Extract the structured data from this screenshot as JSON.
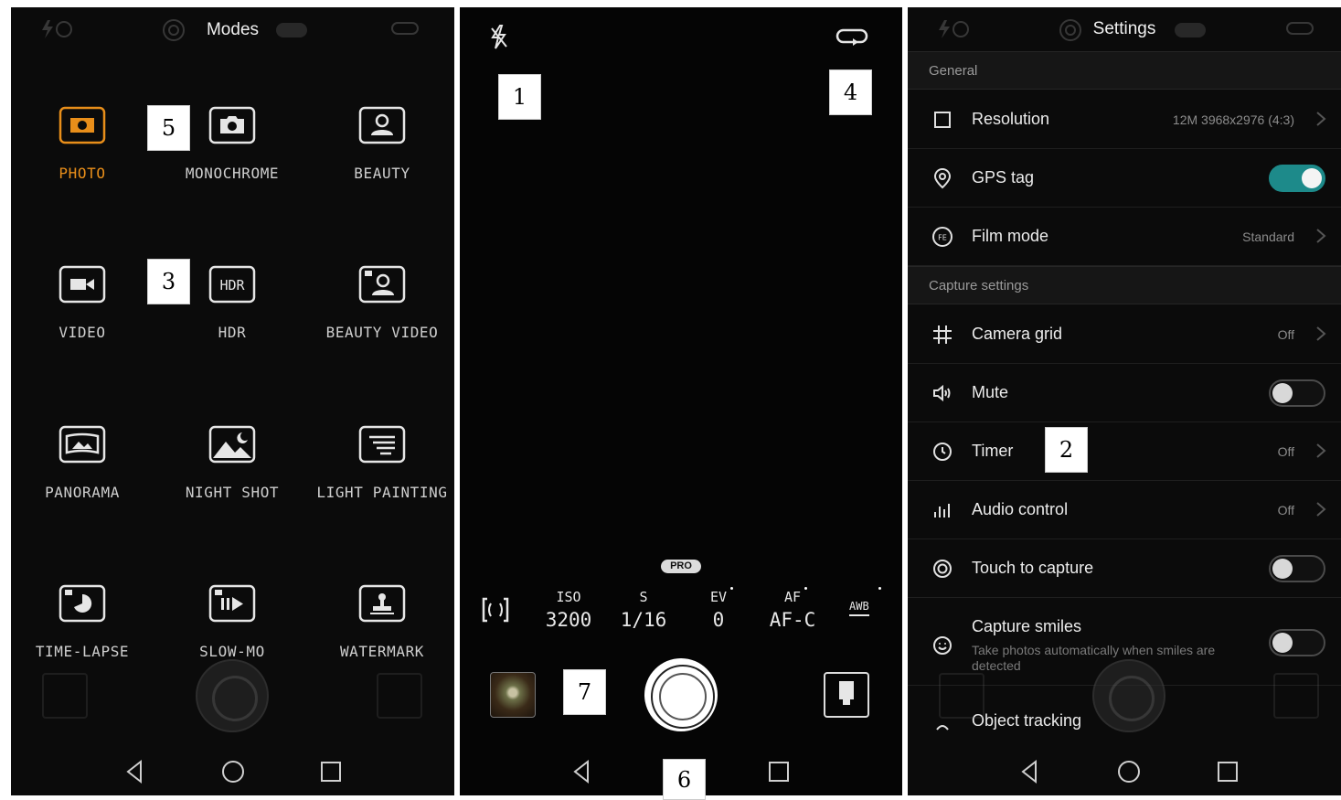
{
  "callouts": [
    "1",
    "2",
    "3",
    "4",
    "5",
    "6",
    "7"
  ],
  "modes_screen": {
    "title": "Modes",
    "active_color": "#e88e1a",
    "modes": [
      {
        "label": "PHOTO",
        "icon": "photo-camera-icon",
        "active": true
      },
      {
        "label": "MONOCHROME",
        "icon": "monochrome-camera-icon",
        "active": false
      },
      {
        "label": "BEAUTY",
        "icon": "beauty-portrait-icon",
        "active": false
      },
      {
        "label": "VIDEO",
        "icon": "video-camera-icon",
        "active": false
      },
      {
        "label": "HDR",
        "icon": "hdr-icon",
        "active": false
      },
      {
        "label": "BEAUTY VIDEO",
        "icon": "beauty-video-icon",
        "active": false
      },
      {
        "label": "PANORAMA",
        "icon": "panorama-icon",
        "active": false
      },
      {
        "label": "NIGHT SHOT",
        "icon": "night-shot-icon",
        "active": false
      },
      {
        "label": "LIGHT PAINTING",
        "icon": "light-painting-icon",
        "active": false
      },
      {
        "label": "TIME-LAPSE",
        "icon": "time-lapse-icon",
        "active": false
      },
      {
        "label": "SLOW-MO",
        "icon": "slow-mo-icon",
        "active": false
      },
      {
        "label": "WATERMARK",
        "icon": "watermark-icon",
        "active": false
      }
    ]
  },
  "camera_screen": {
    "pro_badge": "PRO",
    "params": [
      {
        "key": "ISO",
        "value": "3200"
      },
      {
        "key": "S",
        "value": "1/16"
      },
      {
        "key": "EV",
        "value": "0"
      },
      {
        "key": "AF",
        "value": "AF-C"
      }
    ],
    "awb_label": "AWB"
  },
  "settings_screen": {
    "title": "Settings",
    "accent_color": "#1d8a8a",
    "general_header": "General",
    "capture_header": "Capture settings",
    "resolution": {
      "label": "Resolution",
      "value": "12M 3968x2976 (4:3)"
    },
    "gps": {
      "label": "GPS tag",
      "on": true
    },
    "film": {
      "label": "Film mode",
      "value": "Standard"
    },
    "grid": {
      "label": "Camera grid",
      "value": "Off"
    },
    "mute": {
      "label": "Mute",
      "on": false
    },
    "timer": {
      "label": "Timer",
      "value": "Off"
    },
    "audio": {
      "label": "Audio control",
      "value": "Off"
    },
    "touch": {
      "label": "Touch to capture",
      "on": false
    },
    "smiles": {
      "label": "Capture smiles",
      "desc_line1": "Take photos automatically when smiles are",
      "desc_line2": "detected",
      "on": false
    },
    "tracking": {
      "label": "Object tracking"
    }
  }
}
